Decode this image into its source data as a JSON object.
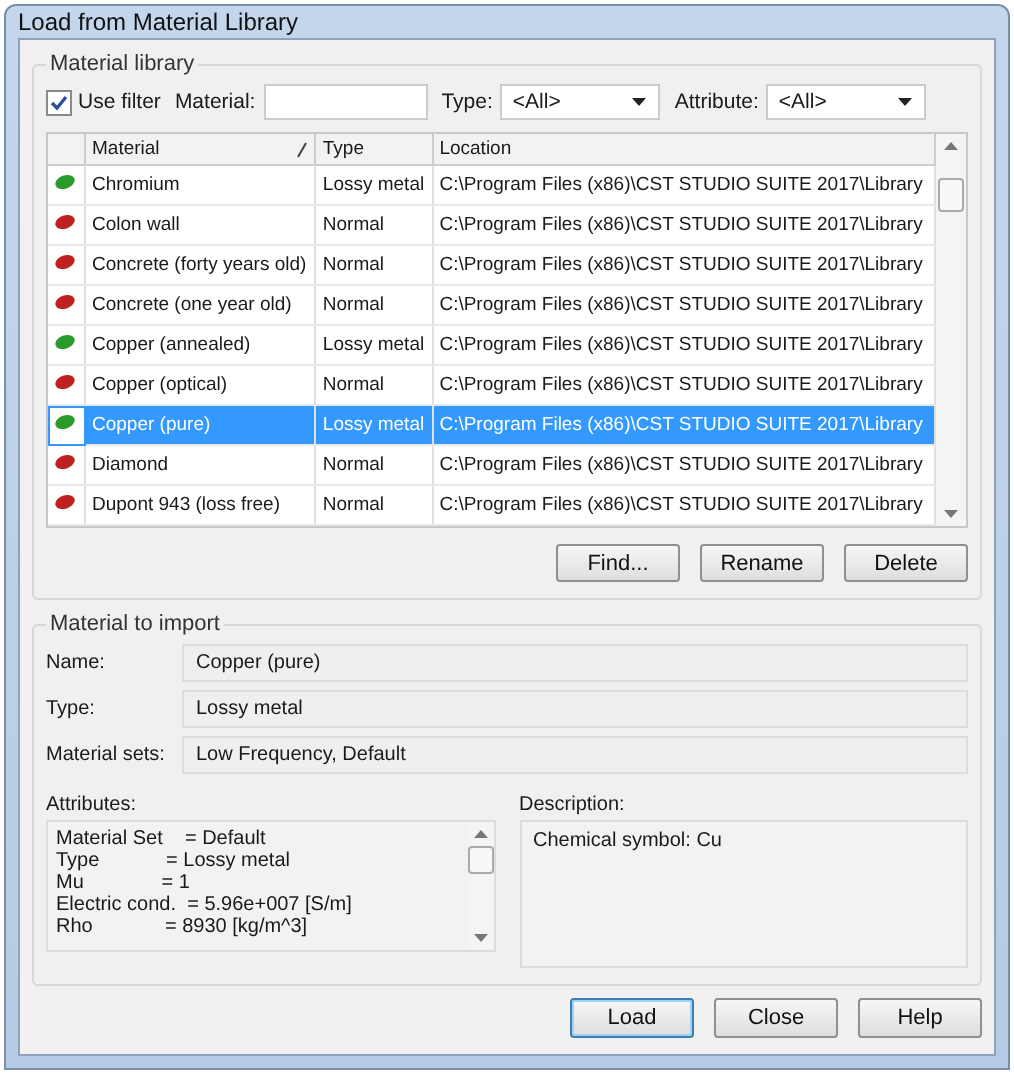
{
  "window": {
    "title": "Load from Material Library"
  },
  "library": {
    "title": "Material library",
    "use_filter": {
      "label": "Use filter",
      "checked": true
    },
    "material_filter": {
      "label": "Material:"
    },
    "type_filter": {
      "label": "Type:",
      "value": "<All>"
    },
    "attribute_filter": {
      "label": "Attribute:",
      "value": "<All>"
    },
    "table": {
      "columns": [
        "Material",
        "Type",
        "Location"
      ],
      "rows": [
        {
          "material": "Chromium",
          "type": "Lossy metal",
          "location": "C:\\Program Files (x86)\\CST STUDIO SUITE 2017\\Library",
          "color": "#2a9a2a",
          "selected": false
        },
        {
          "material": "Colon wall",
          "type": "Normal",
          "location": "C:\\Program Files (x86)\\CST STUDIO SUITE 2017\\Library",
          "color": "#c02020",
          "selected": false
        },
        {
          "material": "Concrete (forty years old)",
          "type": "Normal",
          "location": "C:\\Program Files (x86)\\CST STUDIO SUITE 2017\\Library",
          "color": "#c02020",
          "selected": false
        },
        {
          "material": "Concrete (one year old)",
          "type": "Normal",
          "location": "C:\\Program Files (x86)\\CST STUDIO SUITE 2017\\Library",
          "color": "#c02020",
          "selected": false
        },
        {
          "material": "Copper (annealed)",
          "type": "Lossy metal",
          "location": "C:\\Program Files (x86)\\CST STUDIO SUITE 2017\\Library",
          "color": "#2a9a2a",
          "selected": false
        },
        {
          "material": "Copper (optical)",
          "type": "Normal",
          "location": "C:\\Program Files (x86)\\CST STUDIO SUITE 2017\\Library",
          "color": "#c02020",
          "selected": false
        },
        {
          "material": "Copper (pure)",
          "type": "Lossy metal",
          "location": "C:\\Program Files (x86)\\CST STUDIO SUITE 2017\\Library",
          "color": "#2a9a2a",
          "selected": true
        },
        {
          "material": "Diamond",
          "type": "Normal",
          "location": "C:\\Program Files (x86)\\CST STUDIO SUITE 2017\\Library",
          "color": "#c02020",
          "selected": false
        },
        {
          "material": "Dupont 943 (loss free)",
          "type": "Normal",
          "location": "C:\\Program Files (x86)\\CST STUDIO SUITE 2017\\Library",
          "color": "#c02020",
          "selected": false
        }
      ]
    },
    "buttons": [
      "Find...",
      "Rename",
      "Delete"
    ]
  },
  "import": {
    "title": "Material to import",
    "fields": [
      {
        "label": "Name:",
        "value": "Copper (pure)"
      },
      {
        "label": "Type:",
        "value": "Lossy metal"
      },
      {
        "label": "Material sets:",
        "value": "Low Frequency, Default"
      }
    ],
    "attributes": {
      "label": "Attributes:",
      "lines": [
        "Material Set    = Default",
        "Type            = Lossy metal",
        "Mu              = 1",
        "Electric cond.  = 5.96e+007 [S/m]",
        "Rho             = 8930 [kg/m^3]"
      ]
    },
    "description": {
      "label": "Description:",
      "value": "Chemical symbol: Cu"
    }
  },
  "buttons": [
    {
      "label": "Load",
      "default": true
    },
    {
      "label": "Close",
      "default": false
    },
    {
      "label": "Help",
      "default": false
    }
  ]
}
